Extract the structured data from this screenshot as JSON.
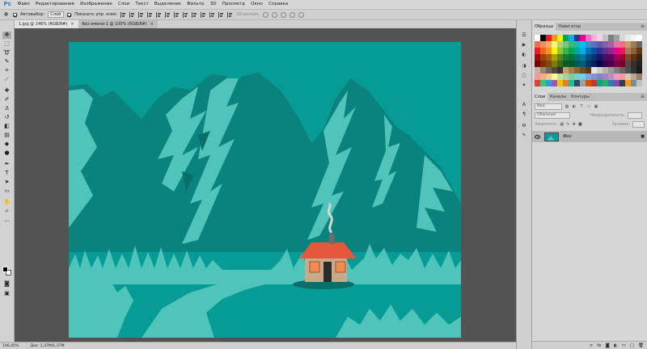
{
  "app": {
    "logo": "Ps"
  },
  "menu": [
    "Файл",
    "Редактирование",
    "Изображение",
    "Слои",
    "Текст",
    "Выделение",
    "Фильтр",
    "3D",
    "Просмотр",
    "Окно",
    "Справка"
  ],
  "options": {
    "autoselect_label": "Автовыбор:",
    "autoselect_value": "Слой",
    "show_controls_label": "Показать упр. элем.",
    "mode_3d_label": "3D-режим:"
  },
  "tabs": [
    {
      "label": "1.jpg @ 146% (RGB/8#)",
      "close": "×"
    },
    {
      "label": "Без имени-1 @ 100% (RGB/8#)",
      "close": "×"
    }
  ],
  "status": {
    "zoom": "146,45%",
    "doc": "Док: 1,37M/1,37M"
  },
  "swatches_panel": {
    "tabs": [
      "Образцы",
      "Навигатор"
    ],
    "colors": [
      "#ffffff",
      "#000000",
      "#ed1c24",
      "#f7941d",
      "#fff200",
      "#00a651",
      "#00aeef",
      "#2e3192",
      "#ec008c",
      "#ff6ec7",
      "#ffb0d8",
      "#f9d0e4",
      "#c0c0c0",
      "#808080",
      "#a0a0a0",
      "#d8d8d8",
      "#e8e8e8",
      "#f4f4f4",
      "#ffffff",
      "#f26c4f",
      "#f68e56",
      "#fbaf5d",
      "#fff568",
      "#acd372",
      "#7cc576",
      "#3bb878",
      "#1abbb4",
      "#00bff3",
      "#438ccb",
      "#5574b9",
      "#605ca8",
      "#855fa8",
      "#a763a8",
      "#f06ea9",
      "#f26d7d",
      "#c69c6d",
      "#9e7b56",
      "#736357",
      "#ed1c24",
      "#f26522",
      "#f7941d",
      "#fff200",
      "#8dc63f",
      "#39b54a",
      "#00a651",
      "#00a99d",
      "#00aeef",
      "#0072bc",
      "#0054a6",
      "#2e3192",
      "#662d91",
      "#92278f",
      "#ec008c",
      "#ed145b",
      "#a67c52",
      "#8c6239",
      "#603913",
      "#9e0b0f",
      "#a0410d",
      "#a36209",
      "#aba000",
      "#598527",
      "#1a7b30",
      "#007236",
      "#00746b",
      "#0076a3",
      "#004a80",
      "#003471",
      "#1b1464",
      "#440e62",
      "#630460",
      "#9e005d",
      "#9e0039",
      "#754c24",
      "#5c3317",
      "#3c2415",
      "#790000",
      "#7b2e00",
      "#7d4900",
      "#827b00",
      "#406618",
      "#005e20",
      "#005826",
      "#005952",
      "#005b7f",
      "#003663",
      "#002157",
      "#0d004c",
      "#32004b",
      "#4b0049",
      "#7b0046",
      "#7a0026",
      "#534741",
      "#362f2d",
      "#231f20",
      "#c7b299",
      "#998675",
      "#736357",
      "#534741",
      "#37302d",
      "#c69c6d",
      "#a67c52",
      "#8c6239",
      "#754c24",
      "#603913",
      "#e6e6e6",
      "#cccccc",
      "#b3b3b3",
      "#999999",
      "#808080",
      "#666666",
      "#4d4d4d",
      "#333333",
      "#1a1a1a",
      "#f5989d",
      "#f9ad81",
      "#fdc68a",
      "#fff79a",
      "#c4df9b",
      "#a3d39c",
      "#82ca9d",
      "#7bcdc8",
      "#6ecff6",
      "#7ea7d8",
      "#8493ca",
      "#8882be",
      "#a187be",
      "#bc8dbf",
      "#f49ac2",
      "#f6989d",
      "#dbc7b0",
      "#b9a58f",
      "#938071",
      "#e73c3c",
      "#2ecc71",
      "#3498db",
      "#9b59b6",
      "#f1c40f",
      "#e67e22",
      "#1abc9c",
      "#34495e",
      "#95a5a6",
      "#d35400",
      "#c0392b",
      "#16a085",
      "#27ae60",
      "#2980b9",
      "#8e44ad",
      "#2c3e50",
      "#f39c12",
      "#7f8c8d",
      "#bdc3c7"
    ]
  },
  "layers_panel": {
    "tabs": [
      "Слои",
      "Каналы",
      "Контуры"
    ],
    "filter_label": "Вид",
    "blend_mode": "Обычные",
    "opacity_label": "Непрозрачность:",
    "lock_label": "Закрепить:",
    "fill_label": "Заливка:",
    "layer_name": "Фон"
  },
  "icons": {
    "menu": "≡",
    "close": "×",
    "lock": "🔒",
    "eye": "eye-icon"
  }
}
